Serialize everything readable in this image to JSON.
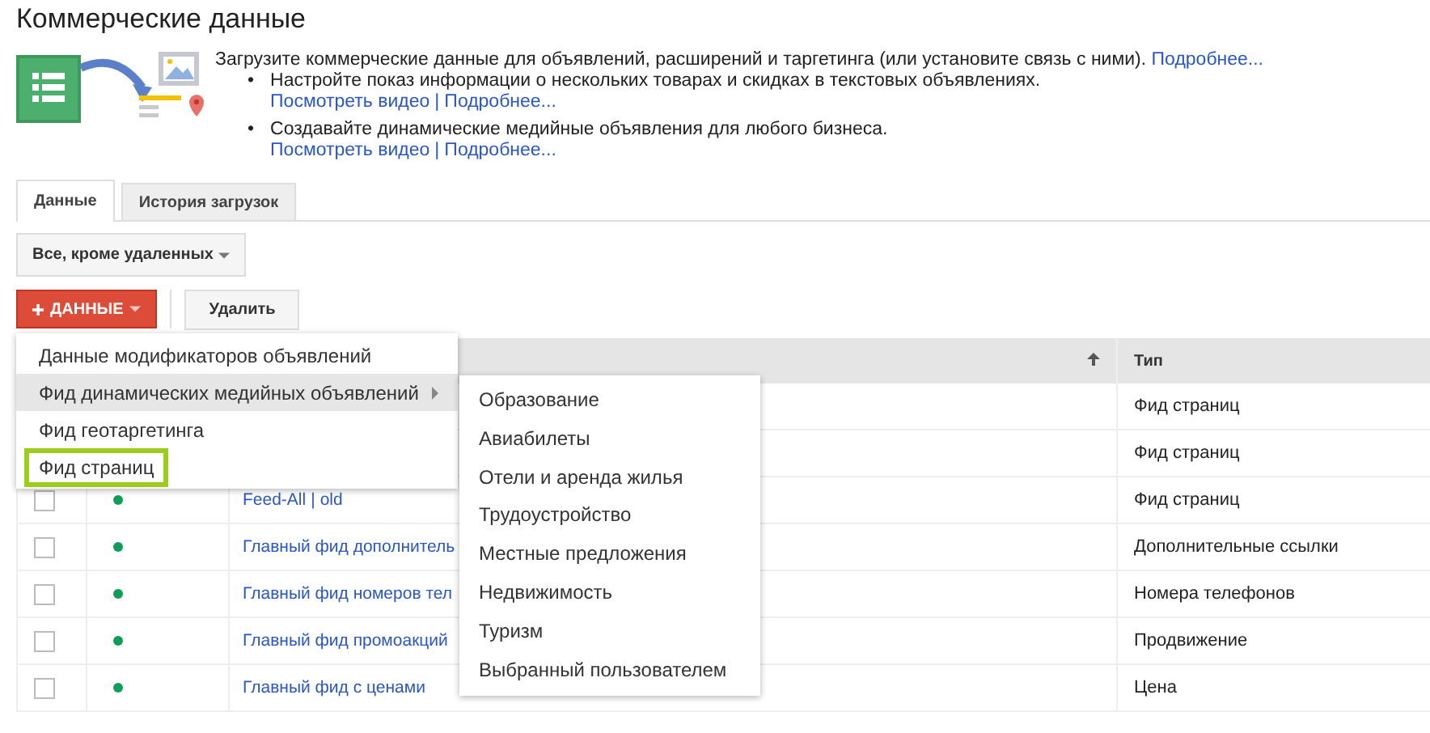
{
  "page": {
    "title": "Коммерческие данные"
  },
  "intro": {
    "text": "Загрузите коммерческие данные для объявлений, расширений и таргетинга (или установите связь с ними).",
    "link": "Подробнее...",
    "bullets": [
      {
        "marker": "•",
        "text": "Настройте показ информации о нескольких товарах и скидках в текстовых объявлениях.",
        "links": [
          "Посмотреть видео",
          "Подробнее..."
        ],
        "separator": "|"
      },
      {
        "marker": "•",
        "text": "Создавайте динамические медийные объявления для любого бизнеса.",
        "links": [
          "Посмотреть видео",
          "Подробнее..."
        ],
        "separator": "|"
      }
    ]
  },
  "tabs": [
    {
      "label": "Данные",
      "selected": true
    },
    {
      "label": "История загрузок",
      "selected": false
    }
  ],
  "filter": {
    "value": "Все, кроме удаленных"
  },
  "toolbar": {
    "add_button": "ДАННЫЕ",
    "delete_button": "Удалить"
  },
  "table": {
    "columns": [
      {
        "sorted": true
      },
      {
        "label": "Тип"
      }
    ],
    "rows": [
      {
        "type": "Фид страниц"
      },
      {
        "type": "Фид страниц"
      },
      {
        "name": "Feed-All",
        "separator": "|",
        "name_suffix": "old",
        "checked": false,
        "enabled": true,
        "type": "Фид страниц"
      },
      {
        "name": "Главный фид дополнитель",
        "checked": false,
        "enabled": true,
        "type": "Дополнительные ссылки"
      },
      {
        "name": "Главный фид номеров тел",
        "checked": false,
        "enabled": true,
        "type": "Номера телефонов"
      },
      {
        "name": "Главный фид промоакций",
        "checked": false,
        "enabled": true,
        "type": "Продвижение"
      },
      {
        "name": "Главный фид с ценами",
        "checked": false,
        "enabled": true,
        "type": "Цена"
      }
    ]
  },
  "menu": {
    "items": [
      {
        "label": "Данные модификаторов объявлений",
        "expanded": false,
        "highlighted": false
      },
      {
        "label": "Фид динамических медийных объявлений",
        "expanded": true,
        "highlighted": false,
        "children": [
          {
            "label": "Образование"
          },
          {
            "label": "Авиабилеты"
          },
          {
            "label": "Отели и аренда жилья"
          },
          {
            "label": "Трудоустройство"
          },
          {
            "label": "Местные предложения"
          },
          {
            "label": "Недвижимость"
          },
          {
            "label": "Туризм"
          },
          {
            "label": "Выбранный пользователем"
          }
        ]
      },
      {
        "label": "Фид геотаргетинга",
        "expanded": false,
        "highlighted": false
      },
      {
        "label": "Фид страниц",
        "expanded": false,
        "highlighted": true
      }
    ]
  }
}
